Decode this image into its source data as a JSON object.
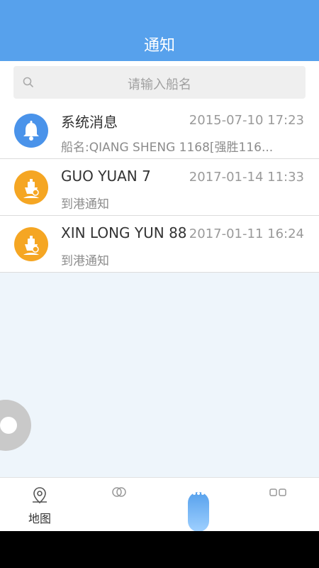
{
  "header": {
    "title": "通知"
  },
  "search": {
    "placeholder": "请输入船名"
  },
  "notifications": [
    {
      "title": "系统消息",
      "time": "2015-07-10 17:23",
      "subtitle": "船名:QIANG SHENG 1168[强胜116...",
      "icon": "bell-icon",
      "color": "#4a93ea"
    },
    {
      "title": "GUO YUAN 7",
      "time": "2017-01-14 11:33",
      "subtitle": "到港通知",
      "icon": "ship-icon",
      "color": "#f5a623"
    },
    {
      "title": "XIN LONG YUN 88",
      "time": "2017-01-11 16:24",
      "subtitle": "到港通知",
      "icon": "ship-icon",
      "color": "#f5a623"
    }
  ],
  "tabbar": {
    "tabs": [
      {
        "label": "地图",
        "icon": "map-pin-icon"
      },
      {
        "label": "",
        "icon": "chat-icon"
      },
      {
        "label": "",
        "icon": "notification-icon",
        "active": true
      },
      {
        "label": "",
        "icon": "grid-icon"
      }
    ]
  },
  "colors": {
    "primary": "#57a1ec",
    "accent_orange": "#f5a623",
    "bell_blue": "#4a93ea",
    "background": "#eef5fb"
  }
}
